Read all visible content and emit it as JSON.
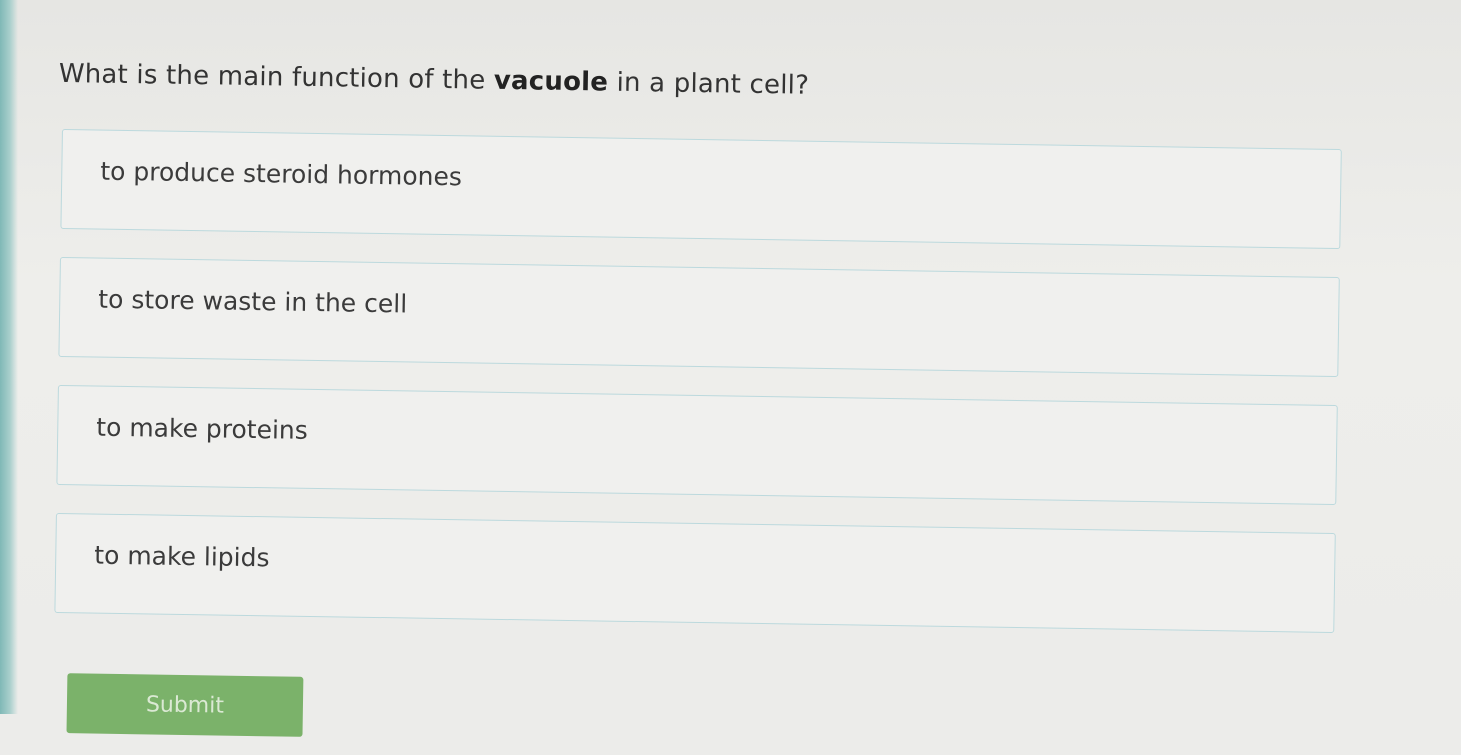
{
  "question": {
    "prefix": "What is the main function of the ",
    "emphasis": "vacuole",
    "suffix": " in a plant cell?"
  },
  "answers": [
    {
      "label": "to produce steroid hormones"
    },
    {
      "label": "to store waste in the cell"
    },
    {
      "label": "to make proteins"
    },
    {
      "label": "to make lipids"
    }
  ],
  "submit": {
    "label": "Submit"
  }
}
